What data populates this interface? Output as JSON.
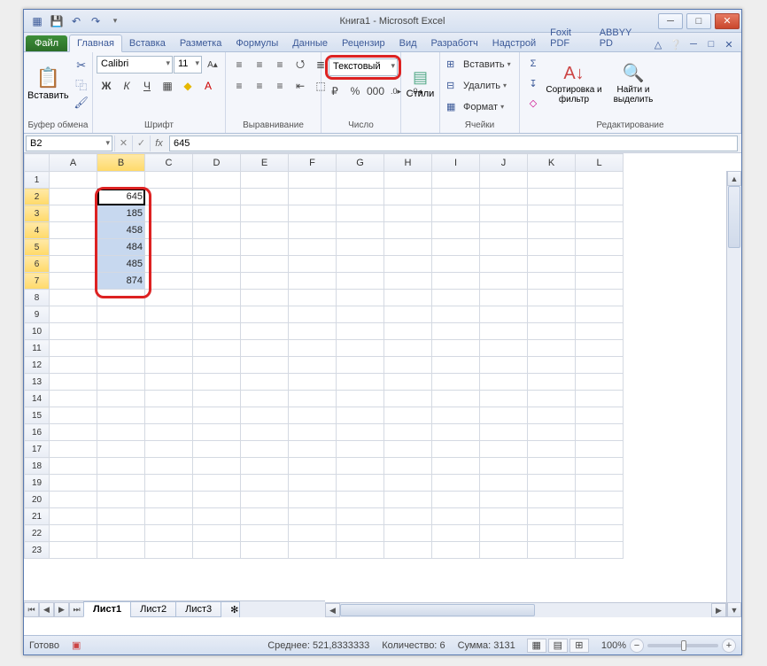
{
  "app": {
    "title": "Книга1 - Microsoft Excel"
  },
  "qat": [
    "save-icon",
    "undo-icon",
    "redo-icon"
  ],
  "tabs": {
    "file": "Файл",
    "items": [
      "Главная",
      "Вставка",
      "Разметка",
      "Формулы",
      "Данные",
      "Рецензир",
      "Вид",
      "Разработч",
      "Надстрой",
      "Foxit PDF",
      "ABBYY PD"
    ],
    "active_index": 0
  },
  "ribbon": {
    "clipboard": {
      "paste": "Вставить",
      "label": "Буфер обмена"
    },
    "font": {
      "name": "Calibri",
      "size": "11",
      "label": "Шрифт"
    },
    "alignment": {
      "label": "Выравнивание"
    },
    "number": {
      "format": "Текстовый",
      "label": "Число"
    },
    "styles": {
      "label": "Стили"
    },
    "cells": {
      "insert": "Вставить",
      "delete": "Удалить",
      "format": "Формат",
      "label": "Ячейки"
    },
    "editing": {
      "sort": "Сортировка и фильтр",
      "find": "Найти и выделить",
      "label": "Редактирование"
    }
  },
  "fx": {
    "name": "B2",
    "fx": "fx",
    "value": "645"
  },
  "grid": {
    "cols": [
      "A",
      "B",
      "C",
      "D",
      "E",
      "F",
      "G",
      "H",
      "I",
      "J",
      "K",
      "L"
    ],
    "rows": 23,
    "selected_col": "B",
    "selected_rows": [
      2,
      3,
      4,
      5,
      6,
      7
    ],
    "active": {
      "row": 2,
      "col": "B"
    },
    "data": {
      "B2": "645",
      "B3": "185",
      "B4": "458",
      "B5": "484",
      "B6": "485",
      "B7": "874"
    }
  },
  "sheets": {
    "items": [
      "Лист1",
      "Лист2",
      "Лист3"
    ],
    "active_index": 0
  },
  "status": {
    "ready": "Готово",
    "avg_label": "Среднее:",
    "avg": "521,8333333",
    "count_label": "Количество:",
    "count": "6",
    "sum_label": "Сумма:",
    "sum": "3131",
    "zoom": "100%"
  }
}
